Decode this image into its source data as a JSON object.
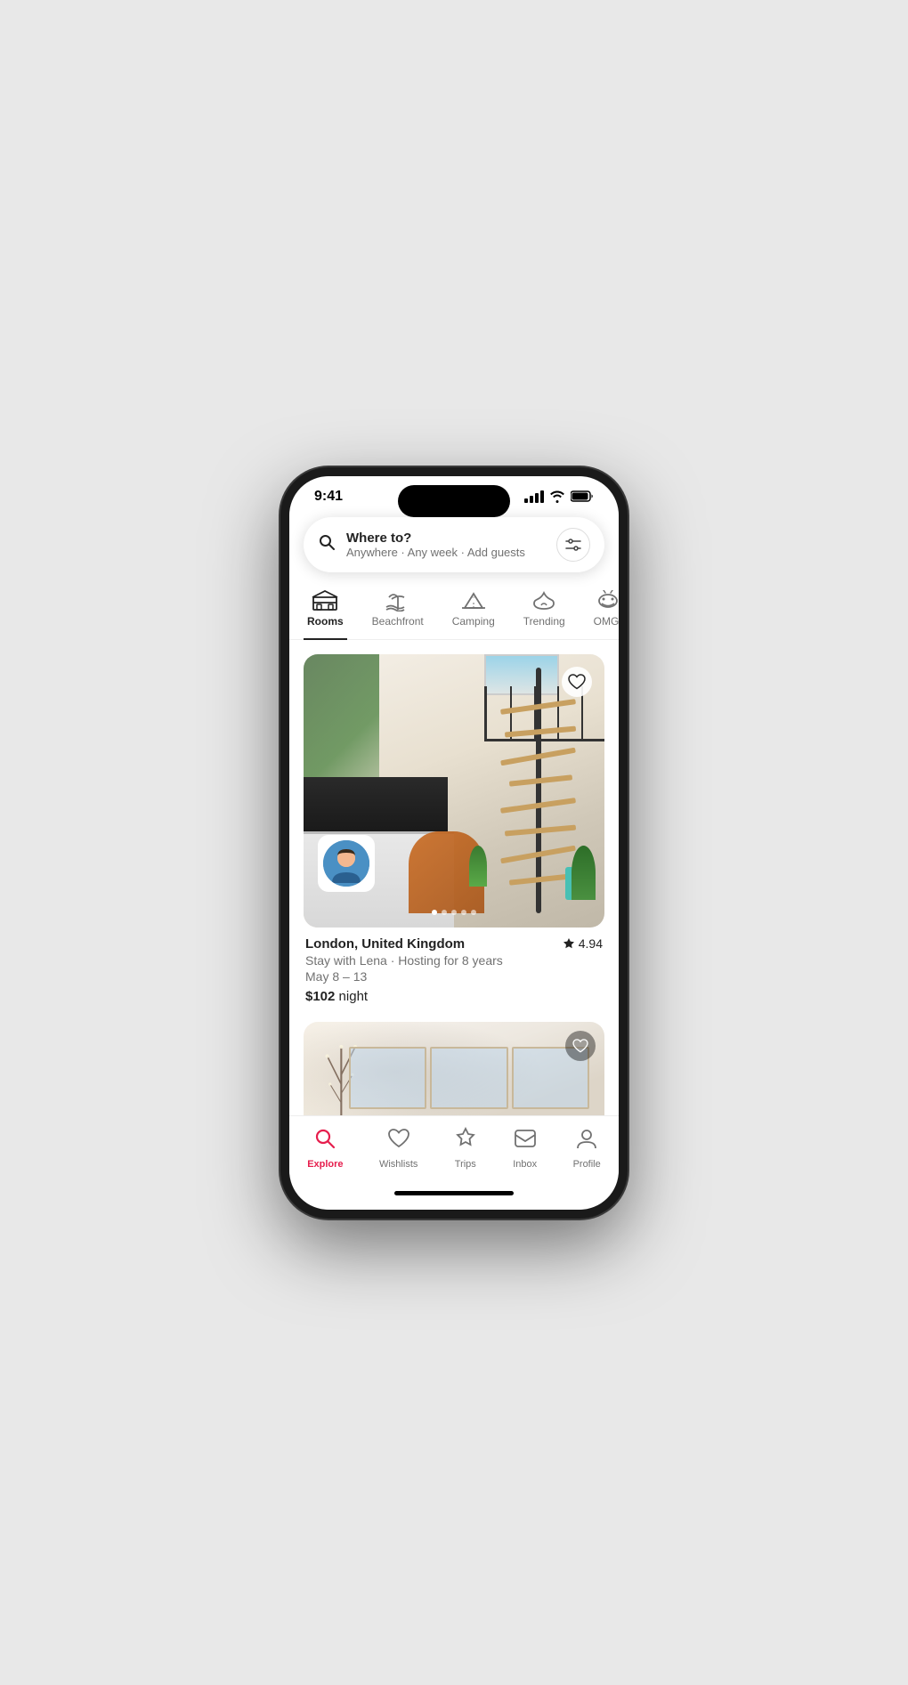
{
  "status_bar": {
    "time": "9:41",
    "signal_label": "signal",
    "wifi_label": "wifi",
    "battery_label": "battery"
  },
  "search": {
    "title": "Where to?",
    "subtitle": "Anywhere · Any week · Add guests",
    "filter_icon": "⇄"
  },
  "categories": [
    {
      "id": "rooms",
      "label": "Rooms",
      "active": true
    },
    {
      "id": "beachfront",
      "label": "Beachfront",
      "active": false
    },
    {
      "id": "camping",
      "label": "Camping",
      "active": false
    },
    {
      "id": "trending",
      "label": "Trending",
      "active": false
    },
    {
      "id": "omg",
      "label": "OMG!",
      "active": false
    }
  ],
  "listings": [
    {
      "location": "London, United Kingdom",
      "rating": "4.94",
      "host": "Stay with Lena · Hosting for 8 years",
      "dates": "May 8 – 13",
      "price": "$102",
      "price_unit": "night",
      "dots": 5,
      "active_dot": 0
    }
  ],
  "bottom_nav": [
    {
      "id": "explore",
      "label": "Explore",
      "active": true
    },
    {
      "id": "wishlists",
      "label": "Wishlists",
      "active": false
    },
    {
      "id": "trips",
      "label": "Trips",
      "active": false
    },
    {
      "id": "inbox",
      "label": "Inbox",
      "active": false
    },
    {
      "id": "profile",
      "label": "Profile",
      "active": false
    }
  ]
}
